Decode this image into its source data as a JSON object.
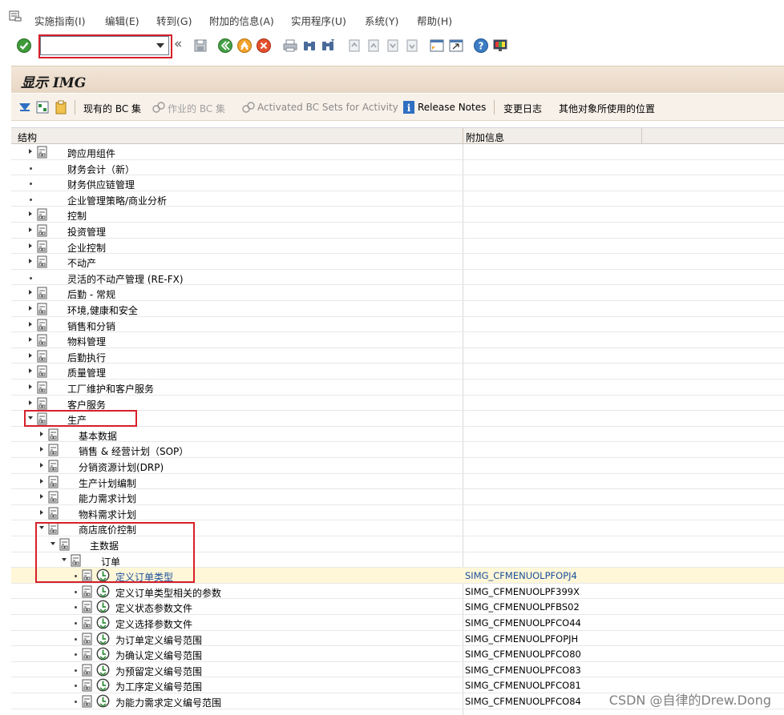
{
  "menubar": {
    "items": [
      {
        "label": "实施指南(I)"
      },
      {
        "label": "编辑(E)"
      },
      {
        "label": "转到(G)"
      },
      {
        "label": "附加的信息(A)"
      },
      {
        "label": "实用程序(U)"
      },
      {
        "label": "系统(Y)"
      },
      {
        "label": "帮助(H)"
      }
    ]
  },
  "toolbar": {
    "command_field_value": ""
  },
  "page": {
    "title": "显示 IMG"
  },
  "app_toolbar": {
    "existing_bc_sets": "现有的 BC 集",
    "bc_sets_for_activity": "作业的 BC 集",
    "activated_bc_sets": "Activated BC Sets for Activity",
    "release_notes": "Release Notes",
    "change_log": "变更日志",
    "where_used": "其他对象所使用的位置"
  },
  "tree": {
    "header_structure": "结构",
    "header_additional_info": "附加信息",
    "rows": [
      {
        "label": "跨应用组件",
        "info": ""
      },
      {
        "label": "财务会计（新）",
        "info": ""
      },
      {
        "label": "财务供应链管理",
        "info": ""
      },
      {
        "label": "企业管理策略/商业分析",
        "info": ""
      },
      {
        "label": "控制",
        "info": ""
      },
      {
        "label": "投资管理",
        "info": ""
      },
      {
        "label": "企业控制",
        "info": ""
      },
      {
        "label": "不动产",
        "info": ""
      },
      {
        "label": "灵活的不动产管理 (RE-FX)",
        "info": ""
      },
      {
        "label": "后勤 - 常规",
        "info": ""
      },
      {
        "label": "环境,健康和安全",
        "info": ""
      },
      {
        "label": "销售和分销",
        "info": ""
      },
      {
        "label": "物料管理",
        "info": ""
      },
      {
        "label": "后勤执行",
        "info": ""
      },
      {
        "label": "质量管理",
        "info": ""
      },
      {
        "label": "工厂维护和客户服务",
        "info": ""
      },
      {
        "label": "客户服务",
        "info": ""
      },
      {
        "label": "生产",
        "info": ""
      },
      {
        "label": "基本数据",
        "info": ""
      },
      {
        "label": "销售 & 经营计划（SOP）",
        "info": ""
      },
      {
        "label": "分销资源计划(DRP)",
        "info": ""
      },
      {
        "label": "生产计划编制",
        "info": ""
      },
      {
        "label": "能力需求计划",
        "info": ""
      },
      {
        "label": "物料需求计划",
        "info": ""
      },
      {
        "label": "商店底价控制",
        "info": ""
      },
      {
        "label": "主数据",
        "info": ""
      },
      {
        "label": "订单",
        "info": ""
      },
      {
        "label": "定义订单类型",
        "info": "SIMG_CFMENUOLPFOPJ4"
      },
      {
        "label": "定义订单类型相关的参数",
        "info": "SIMG_CFMENUOLPF399X"
      },
      {
        "label": "定义状态参数文件",
        "info": "SIMG_CFMENUOLPFBS02"
      },
      {
        "label": "定义选择参数文件",
        "info": "SIMG_CFMENUOLPFCO44"
      },
      {
        "label": "为订单定义编号范围",
        "info": "SIMG_CFMENUOLPFOPJH"
      },
      {
        "label": "为确认定义编号范围",
        "info": "SIMG_CFMENUOLPFCO80"
      },
      {
        "label": "为预留定义编号范围",
        "info": "SIMG_CFMENUOLPFCO83"
      },
      {
        "label": "为工序定义编号范围",
        "info": "SIMG_CFMENUOLPFCO81"
      },
      {
        "label": "为能力需求定义编号范围",
        "info": "SIMG_CFMENUOLPFCO84"
      }
    ]
  },
  "watermark": "CSDN @自律的Drew.Dong",
  "colors": {
    "title_bg": "#ecdccb",
    "highlight_frame": "#d6202a",
    "link_blue": "#1a4f9c"
  }
}
